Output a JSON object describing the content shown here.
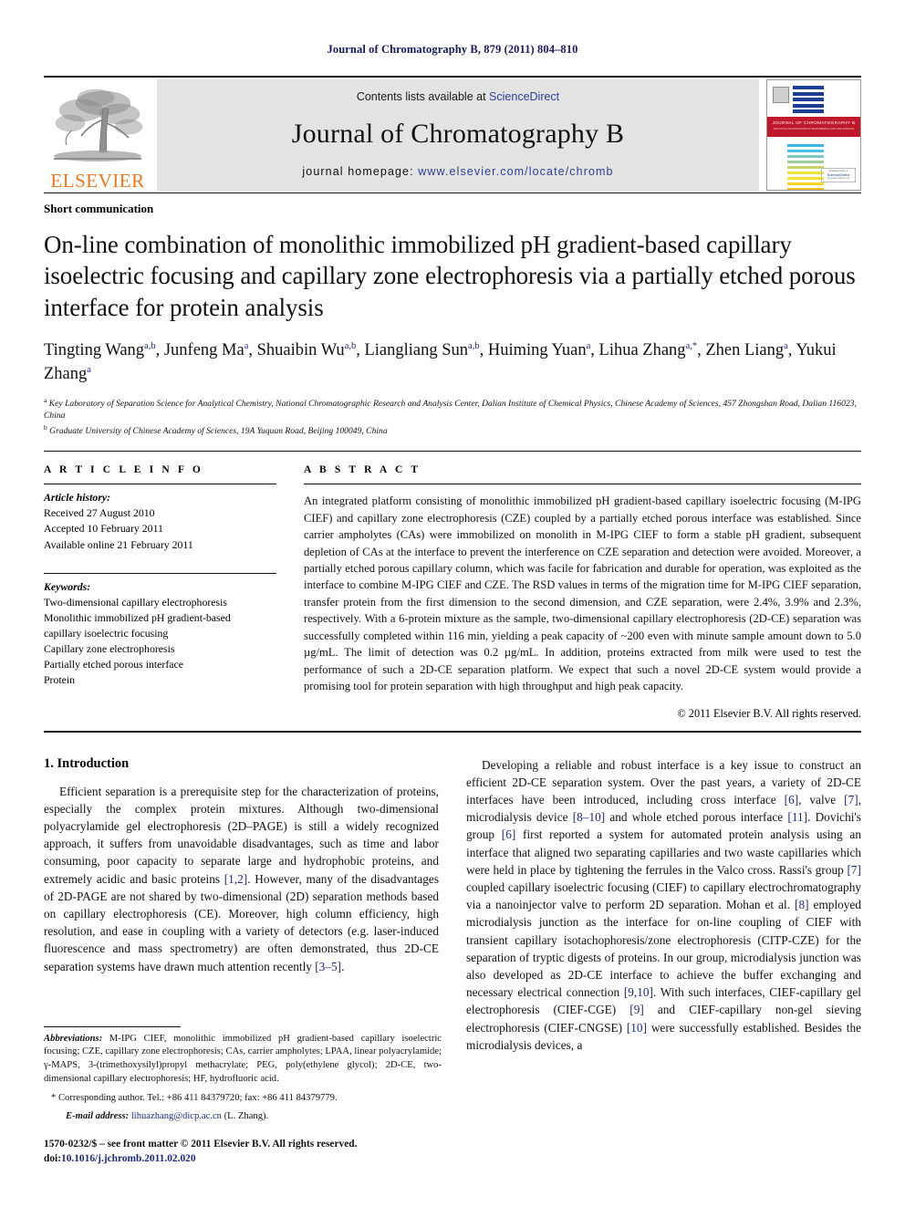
{
  "running_head": "Journal of Chromatography B, 879 (2011) 804–810",
  "masthead": {
    "publisher_name": "ELSEVIER",
    "contents_prefix": "Contents lists available at",
    "contents_link": "ScienceDirect",
    "journal_title": "Journal of Chromatography B",
    "homepage_prefix": "journal homepage:",
    "homepage_url": "www.elsevier.com/locate/chromb",
    "cover": {
      "band_title": "JOURNAL OF CHROMATOGRAPHY B",
      "band_subtitle": "ANALYTICAL TECHNOLOGIES IN THE BIOMEDICAL AND LIFE SCIENCES",
      "badge_top": "Available online at",
      "badge_main": "ScienceDirect",
      "badge_bottom": "www.sciencedirect.com"
    }
  },
  "article": {
    "type": "Short communication",
    "title": "On-line combination of monolithic immobilized pH gradient-based capillary isoelectric focusing and capillary zone electrophoresis via a partially etched porous interface for protein analysis",
    "authors_line1": "Tingting Wang",
    "authors_html": "Tingting Wang<sup>a,b</sup>, Junfeng Ma<sup>a</sup>, Shuaibin Wu<sup>a,b</sup>, Liangliang Sun<sup>a,b</sup>, Huiming Yuan<sup>a</sup>, Lihua Zhang<sup>a,*</sup>, Zhen Liang<sup>a</sup>, Yukui Zhang<sup>a</sup>",
    "affiliation_a": "Key Laboratory of Separation Science for Analytical Chemistry, National Chromatographic Research and Analysis Center, Dalian Institute of Chemical Physics, Chinese Academy of Sciences, 457 Zhongshan Road, Dalian 116023, China",
    "affiliation_b": "Graduate University of Chinese Academy of Sciences, 19A Yuquan Road, Beijing 100049, China"
  },
  "article_info": {
    "heading": "A R T I C L E   I N F O",
    "history_label": "Article history:",
    "history": [
      "Received 27 August 2010",
      "Accepted 10 February 2011",
      "Available online 21 February 2011"
    ],
    "keywords_label": "Keywords:",
    "keywords": [
      "Two-dimensional capillary electrophoresis",
      "Monolithic immobilized pH gradient-based",
      "capillary isoelectric focusing",
      "Capillary zone electrophoresis",
      "Partially etched porous interface",
      "Protein"
    ]
  },
  "abstract": {
    "heading": "A B S T R A C T",
    "text": "An integrated platform consisting of monolithic immobilized pH gradient-based capillary isoelectric focusing (M-IPG CIEF) and capillary zone electrophoresis (CZE) coupled by a partially etched porous interface was established. Since carrier ampholytes (CAs) were immobilized on monolith in M-IPG CIEF to form a stable pH gradient, subsequent depletion of CAs at the interface to prevent the interference on CZE separation and detection were avoided. Moreover, a partially etched porous capillary column, which was facile for fabrication and durable for operation, was exploited as the interface to combine M-IPG CIEF and CZE. The RSD values in terms of the migration time for M-IPG CIEF separation, transfer protein from the first dimension to the second dimension, and CZE separation, were 2.4%, 3.9% and 2.3%, respectively. With a 6-protein mixture as the sample, two-dimensional capillary electrophoresis (2D-CE) separation was successfully completed within 116 min, yielding a peak capacity of ~200 even with minute sample amount down to 5.0 µg/mL. The limit of detection was 0.2 µg/mL. In addition, proteins extracted from milk were used to test the performance of such a 2D-CE separation platform. We expect that such a novel 2D-CE system would provide a promising tool for protein separation with high throughput and high peak capacity.",
    "copyright": "© 2011 Elsevier B.V. All rights reserved."
  },
  "introduction": {
    "heading": "1.  Introduction",
    "para1": "Efficient separation is a prerequisite step for the characterization of proteins, especially the complex protein mixtures. Although two-dimensional polyacrylamide gel electrophoresis (2D–PAGE) is still a widely recognized approach, it suffers from unavoidable disadvantages, such as time and labor consuming, poor capacity to separate large and hydrophobic proteins, and extremely acidic and basic proteins [1,2]. However, many of the disadvantages of 2D-PAGE are not shared by two-dimensional (2D) separation methods based on capillary electrophoresis (CE). Moreover, high column efficiency, high resolution, and ease in coupling with a variety of detectors (e.g. laser-induced fluorescence and mass spectrometry) are often demonstrated, thus 2D-CE separation systems have drawn much attention recently [3–5].",
    "para2": "Developing a reliable and robust interface is a key issue to construct an efficient 2D-CE separation system. Over the past years, a variety of 2D-CE interfaces have been introduced, including cross interface [6], valve [7], microdialysis device [8–10] and whole etched porous interface [11]. Dovichi's group [6] first reported a system for automated protein analysis using an interface that aligned two separating capillaries and two waste capillaries which were held in place by tightening the ferrules in the Valco cross. Rassi's group [7] coupled capillary isoelectric focusing (CIEF) to capillary electrochromatography via a nanoinjector valve to perform 2D separation. Mohan et al. [8] employed microdialysis junction as the interface for on-line coupling of CIEF with transient capillary isotachophoresis/zone electrophoresis (CITP-CZE) for the separation of tryptic digests of proteins. In our group, microdialysis junction was also developed as 2D-CE interface to achieve the buffer exchanging and necessary electrical connection [9,10]. With such interfaces, CIEF-capillary gel electrophoresis (CIEF-CGE) [9] and CIEF-capillary non-gel sieving electrophoresis (CIEF-CNGSE) [10] were successfully established. Besides the microdialysis devices, a"
  },
  "footnotes": {
    "abbrev_label": "Abbreviations:",
    "abbrev_text": "M-IPG CIEF, monolithic immobilized pH gradient-based capillary isoelectric focusing; CZE, capillary zone electrophoresis; CAs, carrier ampholytes; LPAA, linear polyacrylamide; γ-MAPS, 3-(trimethoxysilyl)propyl methacrylate; PEG, poly(ethylene glycol); 2D-CE, two-dimensional capillary electrophoresis; HF, hydrofluoric acid.",
    "corresponding": "* Corresponding author. Tel.: +86 411 84379720; fax: +86 411 84379779.",
    "email_label": "E-mail address:",
    "email": "lihuazhang@dicp.ac.cn",
    "email_suffix": "(L. Zhang)."
  },
  "footer": {
    "issn_line": "1570-0232/$ – see front matter © 2011 Elsevier B.V. All rights reserved.",
    "doi_label": "doi:",
    "doi": "10.1016/j.jchromb.2011.02.020"
  },
  "colors": {
    "link": "#1d2a7a",
    "running_head": "#151a5e",
    "elsevier_orange": "#e87722",
    "banner_bg": "#e3e3e3",
    "cover_red": "#c0182b"
  }
}
